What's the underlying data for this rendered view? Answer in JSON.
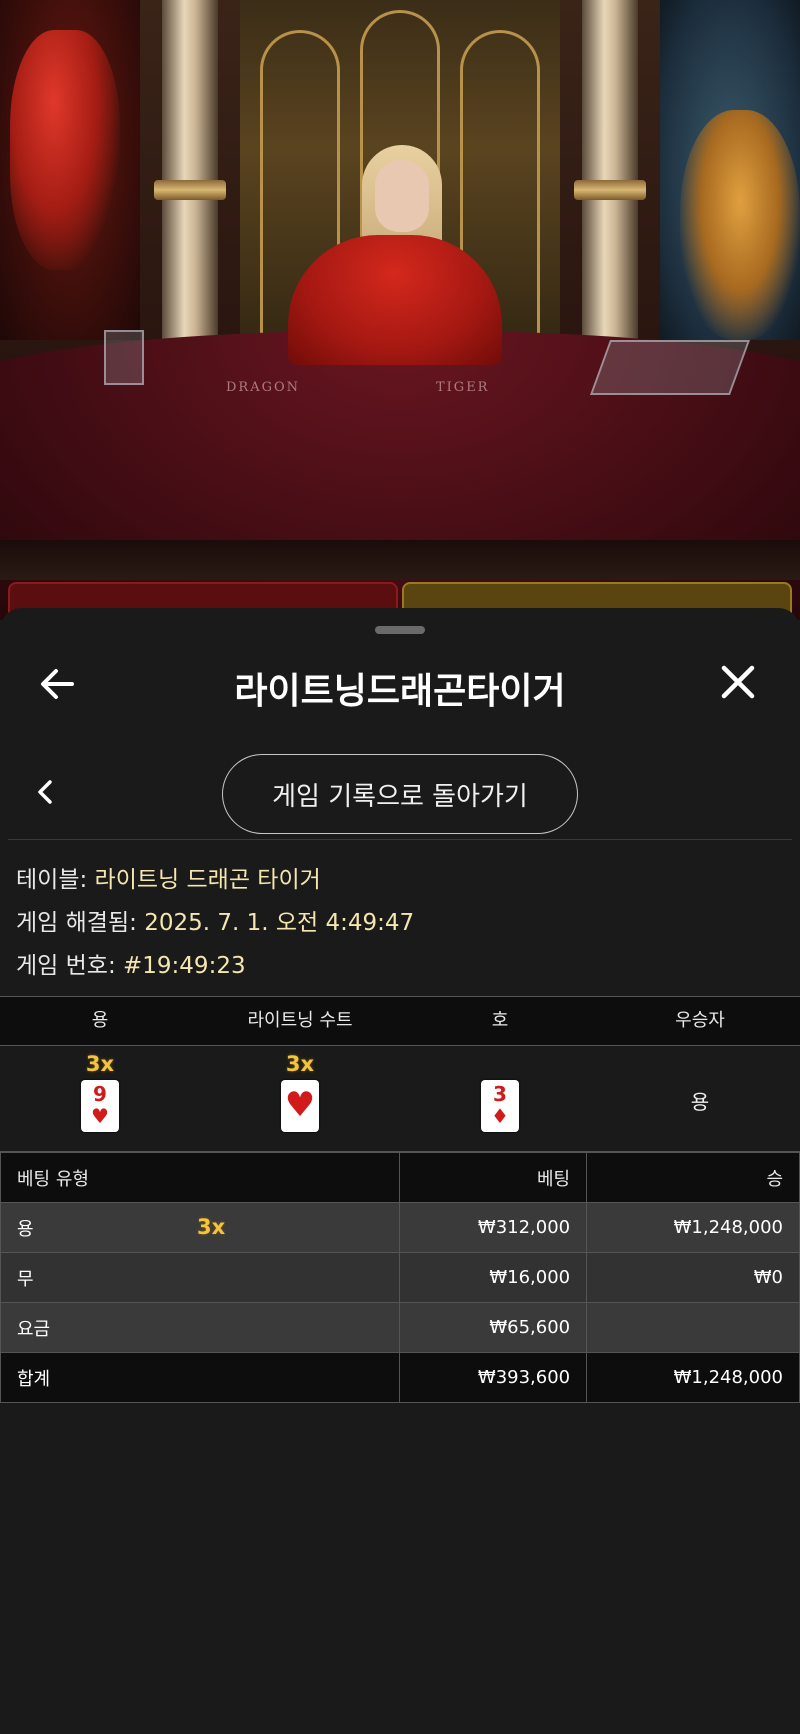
{
  "video": {
    "left_table_label": "DRAGON",
    "right_table_label": "TIGER"
  },
  "header": {
    "title": "라이트닝드래곤타이거",
    "back_icon": "back-arrow-icon",
    "close_icon": "close-icon"
  },
  "nav": {
    "prev_icon": "chevron-left-icon",
    "back_to_history_label": "게임 기록으로 돌아가기"
  },
  "info": {
    "table_label": "테이블:",
    "table_value": "라이트닝 드래곤 타이거",
    "resolved_label": "게임 해결됨:",
    "resolved_value": "2025. 7. 1. 오전 4:49:47",
    "game_no_label": "게임 번호:",
    "game_no_value": "#19:49:23"
  },
  "cards": {
    "headers": [
      "용",
      "라이트닝 수트",
      "호",
      "우승자"
    ],
    "dragon": {
      "multiplier": "3x",
      "rank": "9",
      "suit": "♥"
    },
    "lightning_suit": {
      "multiplier": "3x",
      "suit": "♥"
    },
    "tiger": {
      "rank": "3",
      "suit": "♦"
    },
    "winner": "용",
    "card_color": "#d11a1a"
  },
  "bets": {
    "headers": {
      "type": "베팅 유형",
      "bet": "베팅",
      "win": "승"
    },
    "rows": [
      {
        "type": "용",
        "multiplier": "3x",
        "bet": "₩312,000",
        "win": "₩1,248,000"
      },
      {
        "type": "무",
        "bet": "₩16,000",
        "win": "₩0"
      },
      {
        "type": "요금",
        "bet": "₩65,600",
        "win": ""
      }
    ],
    "total": {
      "type": "합계",
      "bet": "₩393,600",
      "win": "₩1,248,000"
    }
  },
  "colors": {
    "accent_gold": "#f2c440",
    "info_value": "#f5e6b0",
    "sheet_bg": "#1a1a1a"
  }
}
